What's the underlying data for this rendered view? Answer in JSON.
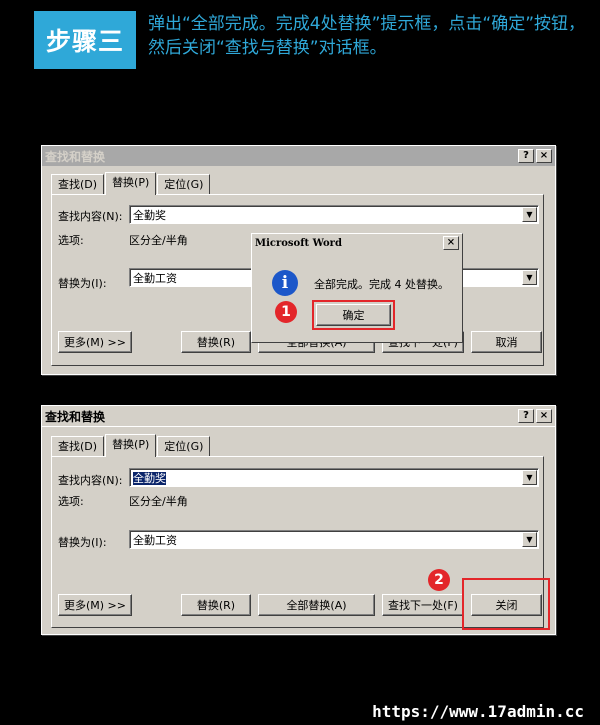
{
  "header": {
    "step_label": "步骤三",
    "instruction": "弹出“全部完成。完成4处替换”提示框，点击“确定”按钮，然后关闭“查找与替换”对话框。"
  },
  "dialog": {
    "title": "查找和替换",
    "help_btn": "?",
    "close_btn": "×",
    "tabs": [
      "查找(D)",
      "替换(P)",
      "定位(G)"
    ],
    "find_label": "查找内容(N):",
    "find_value": "全勤奖",
    "options_label": "选项:",
    "options_value": "区分全/半角",
    "replace_label": "替换为(I):",
    "replace_value": "全勤工资",
    "more_btn": "更多(M) >>",
    "replace_btn": "替换(R)",
    "replace_all_btn": "全部替换(A)",
    "find_next_btn": "查找下一处(F)",
    "cancel_btn": "取消",
    "close_dialog_btn": "关闭"
  },
  "msgbox": {
    "title": "Microsoft Word",
    "close_btn": "×",
    "message": "全部完成。完成 4 处替换。",
    "ok_btn": "确定"
  },
  "markers": [
    "1",
    "2"
  ],
  "watermark": "https://www.17admin.cc",
  "colors": {
    "accent": "#2fa8d8",
    "marker": "#e3262a",
    "selection": "#0a246a"
  }
}
